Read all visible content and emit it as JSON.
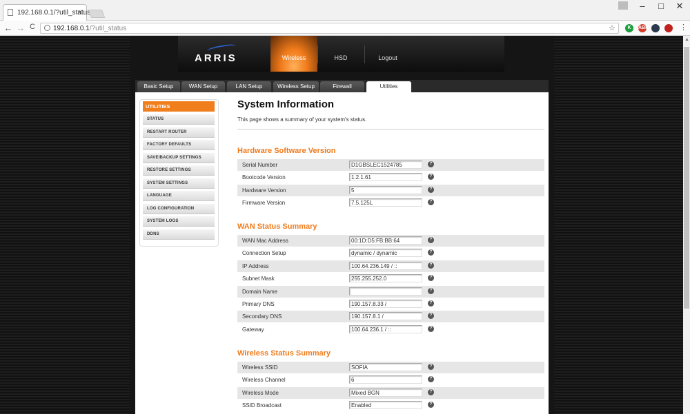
{
  "browser": {
    "tab_title": "192.168.0.1/?util_status",
    "tab_close": "×",
    "win_min": "–",
    "win_max": "□",
    "win_close": "✕",
    "back": "←",
    "forward": "→",
    "reload": "C",
    "url_host": "192.168.0.1",
    "url_path": "/?util_status",
    "star": "☆",
    "menu": "⋮",
    "extensions": [
      {
        "name": "extension-green",
        "label": "K",
        "color": "#1a9e3c"
      },
      {
        "name": "extension-adblock",
        "label": "ABP",
        "color": "#d43c2c"
      },
      {
        "name": "extension-dark",
        "label": "",
        "color": "#2a3a4a"
      },
      {
        "name": "extension-red",
        "label": "",
        "color": "#c0201e"
      }
    ]
  },
  "header": {
    "logo": "ARRIS",
    "nav": [
      "Wireless",
      "HSD",
      "Logout"
    ],
    "active_nav": "Wireless"
  },
  "tabs": [
    "Basic Setup",
    "WAN Setup",
    "LAN Setup",
    "Wireless Setup",
    "Firewall",
    "Utilities"
  ],
  "active_tab": "Utilities",
  "sidebar": {
    "title": "UTILITIES",
    "items": [
      "STATUS",
      "RESTART ROUTER",
      "FACTORY DEFAULTS",
      "SAVE/BACKUP SETTINGS",
      "RESTORE SETTINGS",
      "SYSTEM SETTINGS",
      "LANGUAGE",
      "LOG CONFIGURATION",
      "SYSTEM LOGS",
      "DDNS"
    ]
  },
  "main": {
    "title": "System Information",
    "description": "This page shows a summary of your system's status.",
    "help_glyph": "?",
    "sections": [
      {
        "title": "Hardware Software Version",
        "rows": [
          {
            "label": "Serial Number",
            "value": "D1GBSLEC1524785"
          },
          {
            "label": "Bootcode Version",
            "value": "1.2.1.61"
          },
          {
            "label": "Hardware Version",
            "value": "5"
          },
          {
            "label": "Firmware Version",
            "value": "7.5.125L"
          }
        ]
      },
      {
        "title": "WAN Status Summary",
        "rows": [
          {
            "label": "WAN Mac Address",
            "value": "00:1D:D5:FB:BB:64"
          },
          {
            "label": "Connection Setup",
            "value": "dynamic / dynamic"
          },
          {
            "label": "IP Address",
            "value": "100.64.236.149 / ::"
          },
          {
            "label": "Subnet Mask",
            "value": "255.255.252.0"
          },
          {
            "label": "Domain Name",
            "value": ""
          },
          {
            "label": "Primary DNS",
            "value": "190.157.8.33 /"
          },
          {
            "label": "Secondary DNS",
            "value": "190.157.8.1 /"
          },
          {
            "label": "Gateway",
            "value": "100.64.236.1 / ::"
          }
        ]
      },
      {
        "title": "Wireless Status Summary",
        "rows": [
          {
            "label": "Wireless SSID",
            "value": "SOFIA"
          },
          {
            "label": "Wireless Channel",
            "value": "6"
          },
          {
            "label": "Wireless Mode",
            "value": "Mixed BGN"
          },
          {
            "label": "SSID Broadcast",
            "value": "Enabled"
          }
        ]
      }
    ]
  }
}
